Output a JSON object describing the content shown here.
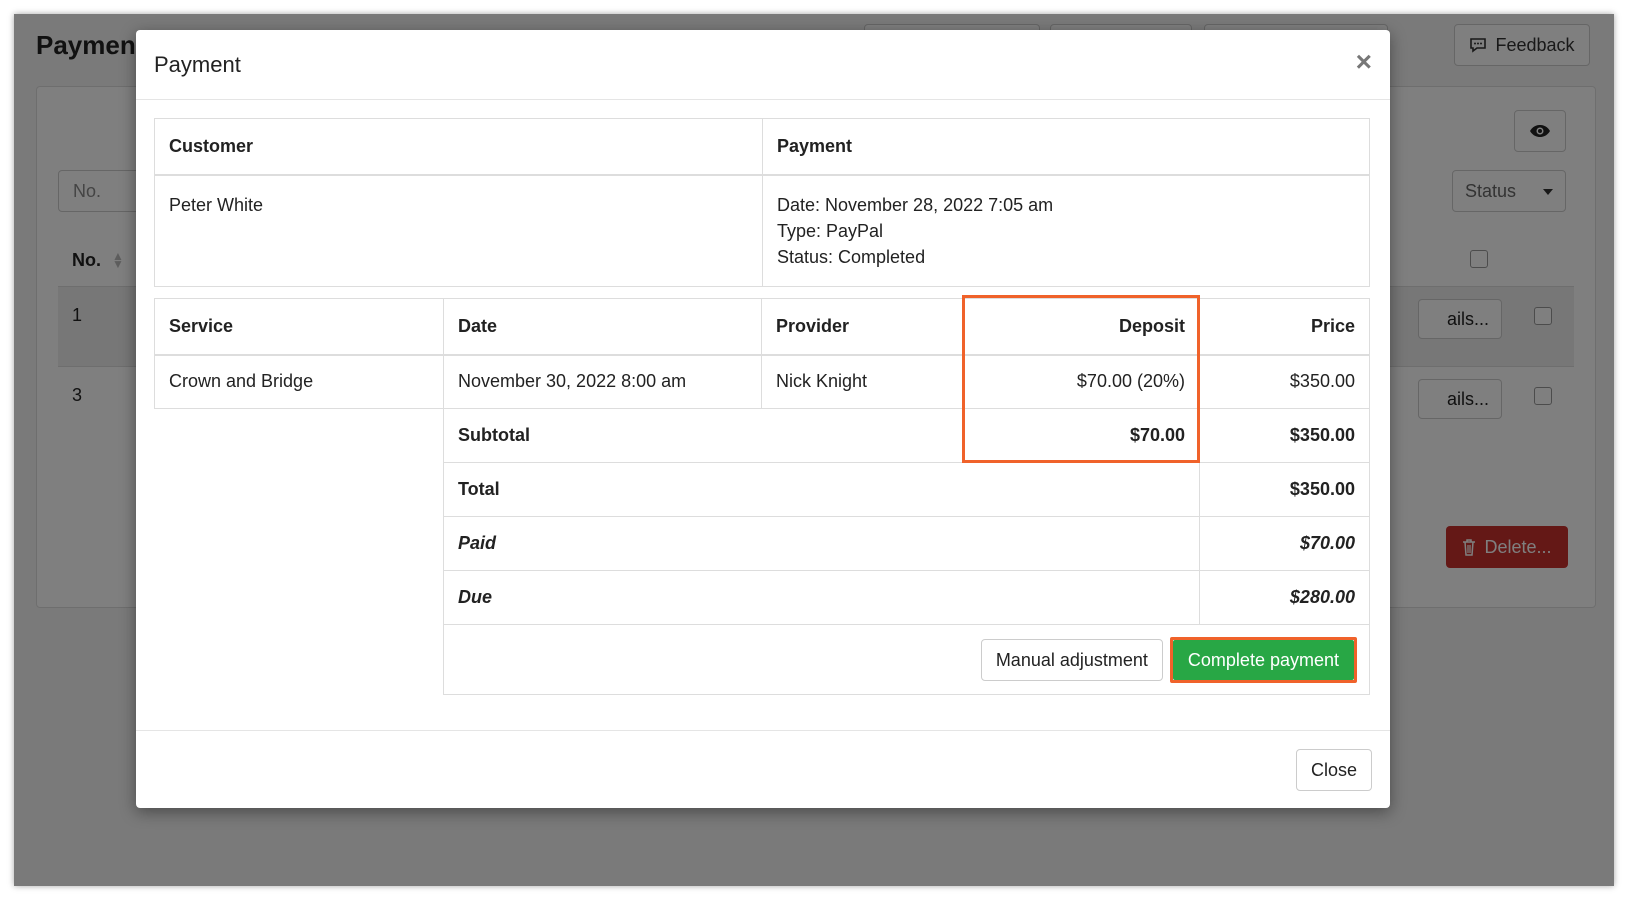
{
  "background": {
    "page_title": "Payment",
    "feedback_label": "Feedback",
    "filter_no_placeholder": "No.",
    "status_select": "Status",
    "column_no": "No.",
    "rows": [
      {
        "no": "1",
        "details": "ails..."
      },
      {
        "no": "3",
        "details": "ails..."
      }
    ],
    "delete_label": "Delete..."
  },
  "modal": {
    "title": "Payment",
    "close_x": "×",
    "info_table": {
      "headers": {
        "customer": "Customer",
        "payment": "Payment"
      },
      "customer_name": "Peter White",
      "payment_date": "Date: November 28, 2022 7:05 am",
      "payment_type": "Type: PayPal",
      "payment_status": "Status: Completed"
    },
    "items_table": {
      "headers": {
        "service": "Service",
        "date": "Date",
        "provider": "Provider",
        "deposit": "Deposit",
        "price": "Price"
      },
      "row": {
        "service": "Crown and Bridge",
        "date": "November 30, 2022 8:00 am",
        "provider": "Nick Knight",
        "deposit": "$70.00 (20%)",
        "price": "$350.00"
      },
      "subtotal": {
        "label": "Subtotal",
        "deposit": "$70.00",
        "price": "$350.00"
      },
      "total": {
        "label": "Total",
        "value": "$350.00"
      },
      "paid": {
        "label": "Paid",
        "value": "$70.00"
      },
      "due": {
        "label": "Due",
        "value": "$280.00"
      },
      "manual_adjustment_label": "Manual adjustment",
      "complete_payment_label": "Complete payment"
    },
    "footer_close_label": "Close"
  },
  "colors": {
    "highlight": "#f0622a",
    "success": "#28a745",
    "danger": "#c9302c"
  }
}
